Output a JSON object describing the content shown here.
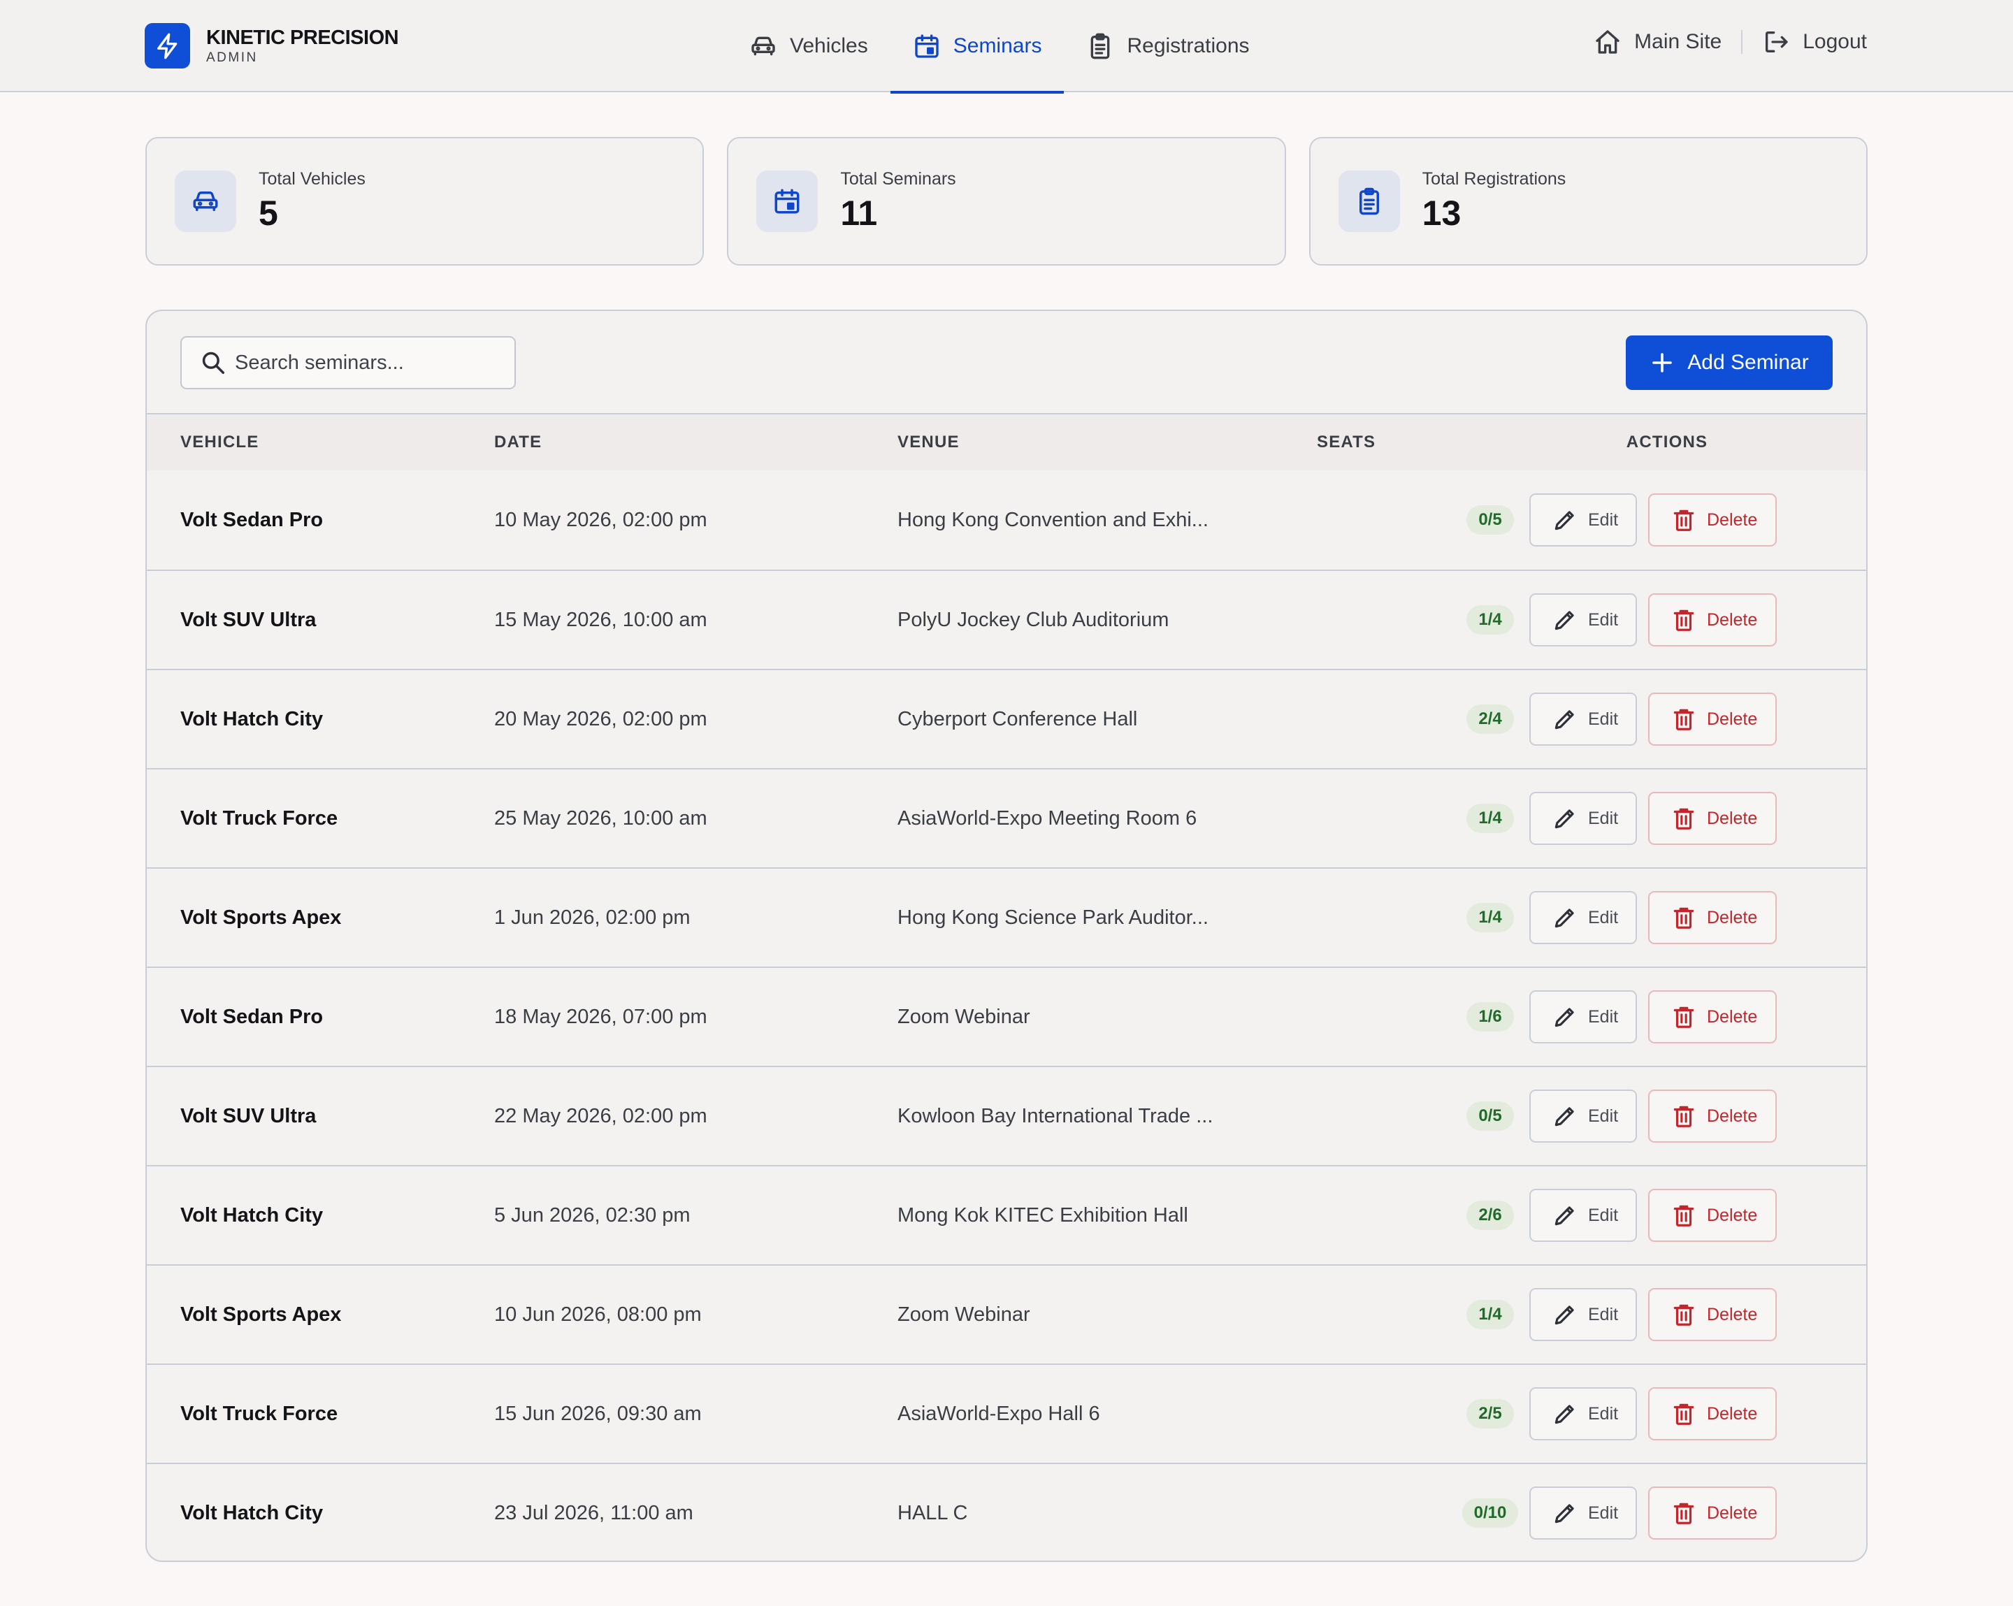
{
  "brand": {
    "name": "KINETIC PRECISION",
    "sub": "ADMIN"
  },
  "nav": [
    {
      "label": "Vehicles",
      "icon": "car-icon",
      "active": false
    },
    {
      "label": "Seminars",
      "icon": "calendar-icon",
      "active": true
    },
    {
      "label": "Registrations",
      "icon": "clipboard-icon",
      "active": false
    }
  ],
  "top_links": {
    "main_site": "Main Site",
    "logout": "Logout"
  },
  "stats": [
    {
      "label": "Total Vehicles",
      "value": "5",
      "icon": "car-icon"
    },
    {
      "label": "Total Seminars",
      "value": "11",
      "icon": "calendar-icon"
    },
    {
      "label": "Total Registrations",
      "value": "13",
      "icon": "clipboard-icon"
    }
  ],
  "search": {
    "placeholder": "Search seminars...",
    "value": ""
  },
  "add_button": "Add Seminar",
  "table": {
    "columns": {
      "vehicle": "VEHICLE",
      "date": "DATE",
      "venue": "VENUE",
      "seats": "SEATS",
      "actions": "ACTIONS"
    },
    "edit_label": "Edit",
    "delete_label": "Delete",
    "rows": [
      {
        "vehicle": "Volt Sedan Pro",
        "date": "10 May 2026, 02:00 pm",
        "venue": "Hong Kong Convention and Exhi...",
        "seats": "0/5"
      },
      {
        "vehicle": "Volt SUV Ultra",
        "date": "15 May 2026, 10:00 am",
        "venue": "PolyU Jockey Club Auditorium",
        "seats": "1/4"
      },
      {
        "vehicle": "Volt Hatch City",
        "date": "20 May 2026, 02:00 pm",
        "venue": "Cyberport Conference Hall",
        "seats": "2/4"
      },
      {
        "vehicle": "Volt Truck Force",
        "date": "25 May 2026, 10:00 am",
        "venue": "AsiaWorld-Expo Meeting Room 6",
        "seats": "1/4"
      },
      {
        "vehicle": "Volt Sports Apex",
        "date": "1 Jun 2026, 02:00 pm",
        "venue": "Hong Kong Science Park Auditor...",
        "seats": "1/4"
      },
      {
        "vehicle": "Volt Sedan Pro",
        "date": "18 May 2026, 07:00 pm",
        "venue": "Zoom Webinar",
        "seats": "1/6"
      },
      {
        "vehicle": "Volt SUV Ultra",
        "date": "22 May 2026, 02:00 pm",
        "venue": "Kowloon Bay International Trade ...",
        "seats": "0/5"
      },
      {
        "vehicle": "Volt Hatch City",
        "date": "5 Jun 2026, 02:30 pm",
        "venue": "Mong Kok KITEC Exhibition Hall",
        "seats": "2/6"
      },
      {
        "vehicle": "Volt Sports Apex",
        "date": "10 Jun 2026, 08:00 pm",
        "venue": "Zoom Webinar",
        "seats": "1/4"
      },
      {
        "vehicle": "Volt Truck Force",
        "date": "15 Jun 2026, 09:30 am",
        "venue": "AsiaWorld-Expo Hall 6",
        "seats": "2/5"
      },
      {
        "vehicle": "Volt Hatch City",
        "date": "23 Jul 2026, 11:00 am",
        "venue": "HALL C",
        "seats": "0/10"
      }
    ]
  },
  "colors": {
    "accent": "#0f4fd8",
    "danger": "#c0262c",
    "badge_bg": "#e2ebdc",
    "badge_text": "#1f6b2a"
  }
}
